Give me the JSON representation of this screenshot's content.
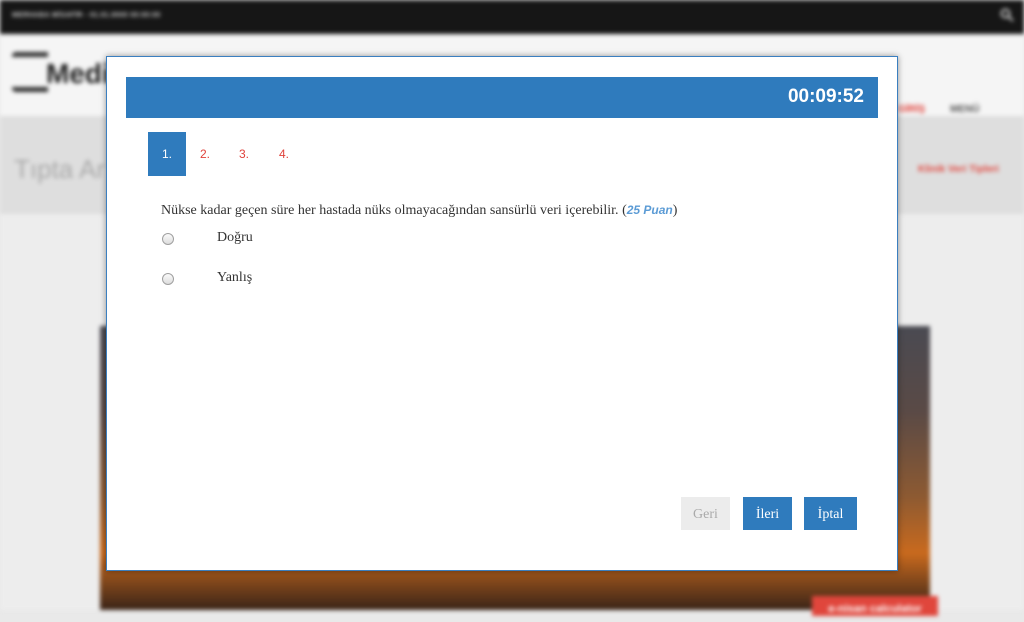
{
  "background": {
    "topbar_text": "MERHABA MİSAFİR - 01.01.0000 00:00:00",
    "logo_text": "Medi",
    "nav_red": "GİRİŞ",
    "nav_item": "MENÜ",
    "page_title": "Tıpta Ar",
    "breadcrumb": "Klinik Veri Tipleri",
    "calc_badge": "e-nisan calculator"
  },
  "modal": {
    "timer": "00:09:52",
    "tabs": [
      {
        "label": "1.",
        "active": true
      },
      {
        "label": "2.",
        "active": false
      },
      {
        "label": "3.",
        "active": false
      },
      {
        "label": "4.",
        "active": false
      }
    ],
    "question": {
      "text": "Nükse kadar geçen süre her hastada nüks olmayacağından sansürlü veri içerebilir.",
      "points_open": "(",
      "points": "25 Puan",
      "points_close": ")"
    },
    "options": [
      {
        "label": "Doğru"
      },
      {
        "label": "Yanlış"
      }
    ],
    "buttons": {
      "back": "Geri",
      "next": "İleri",
      "cancel": "İptal"
    }
  },
  "colors": {
    "accent": "#2f7bbd",
    "tab_inactive": "#e0423b",
    "points": "#5b9bd5"
  }
}
